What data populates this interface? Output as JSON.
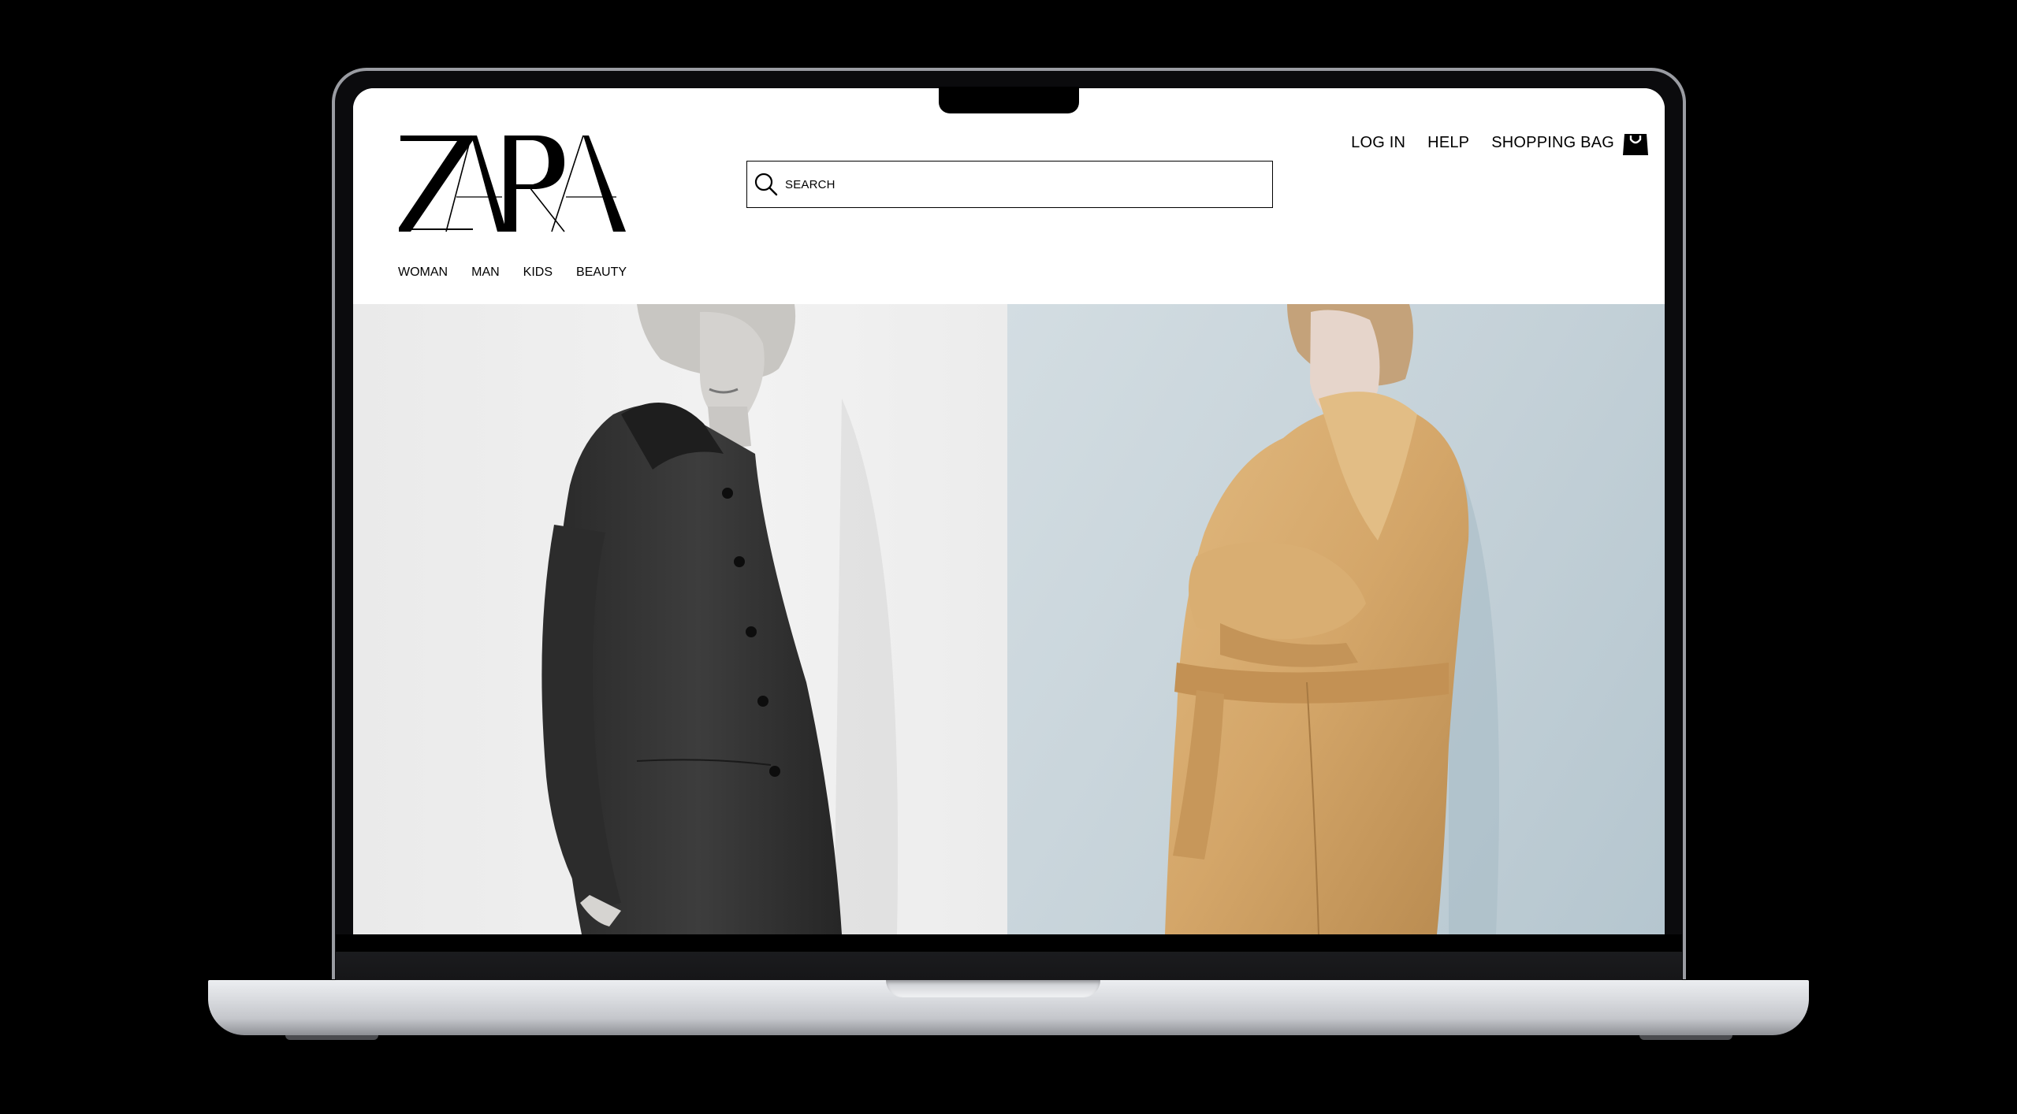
{
  "site": {
    "logo_text": "ZARA",
    "search": {
      "placeholder": "SEARCH"
    },
    "top_nav": {
      "login": "LOG IN",
      "help": "HELP",
      "bag": "SHOPPING BAG"
    },
    "categories": [
      "WOMAN",
      "MAN",
      "KIDS",
      "BEAUTY"
    ]
  },
  "hero": {
    "left_image": "model-in-dark-tweed-coat-bw",
    "right_image": "model-in-camel-faux-fur-coat"
  },
  "colors": {
    "text": "#000000",
    "background": "#ffffff",
    "camel_coat": "#d4a669",
    "right_backdrop": "#c4d1d8",
    "left_backdrop": "#efefef"
  }
}
